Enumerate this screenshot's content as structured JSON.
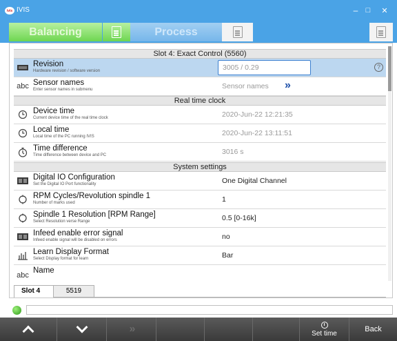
{
  "window": {
    "title": "IVIS",
    "app_badge": "ivis",
    "minimize": "–",
    "maximize": "□",
    "close": "✕"
  },
  "tabs": {
    "balancing": "Balancing",
    "process": "Process"
  },
  "header": "Slot 4: Exact Control (5560)",
  "rows": [
    {
      "title": "Revision",
      "sub": "Hardware revision / software version",
      "value": "3005 / 0.29",
      "icon": "chip-icon"
    },
    {
      "title": "Sensor names",
      "sub": "Enter sensor names in submenu",
      "value": "Sensor names",
      "icon_text": "abc",
      "chevron": "»"
    }
  ],
  "sections": {
    "rtc": "Real time clock",
    "system": "System settings"
  },
  "rtc_rows": [
    {
      "title": "Device time",
      "sub": "Current device time of the real time clock",
      "value": "2020-Jun-22 12:21:35"
    },
    {
      "title": "Local time",
      "sub": "Local time of the PC running IVIS",
      "value": "2020-Jun-22 13:11:51"
    },
    {
      "title": "Time difference",
      "sub": "Time difference between device and PC",
      "value": "3016 s"
    }
  ],
  "system_rows": [
    {
      "title": "Digital IO Configuration",
      "sub": "Set the Digital IO Port functionality",
      "value": "One Digital Channel"
    },
    {
      "title": "RPM Cycles/Revolution spindle 1",
      "sub": "Number of marks used",
      "value": "1"
    },
    {
      "title": "Spindle 1 Resolution [RPM Range]",
      "sub": "Select Resolution verse Range",
      "value": "0.5 [0-16k]"
    },
    {
      "title": "Infeed enable error signal",
      "sub": "Infeed enable signal will be disabled on errors",
      "value": "no"
    },
    {
      "title": "Learn Display Format",
      "sub": "Select Display format for learn",
      "value": "Bar"
    },
    {
      "title": "Name",
      "icon_text": "abc"
    }
  ],
  "help": "?",
  "slots": {
    "active": "Slot 4",
    "other": "5519"
  },
  "toolbar": {
    "set_time": "Set time",
    "back": "Back",
    "ff": "»"
  },
  "colors": {
    "title_bar": "#4aa3e6",
    "selected_row": "#bcd7f0",
    "accent": "#1b4ea8"
  }
}
